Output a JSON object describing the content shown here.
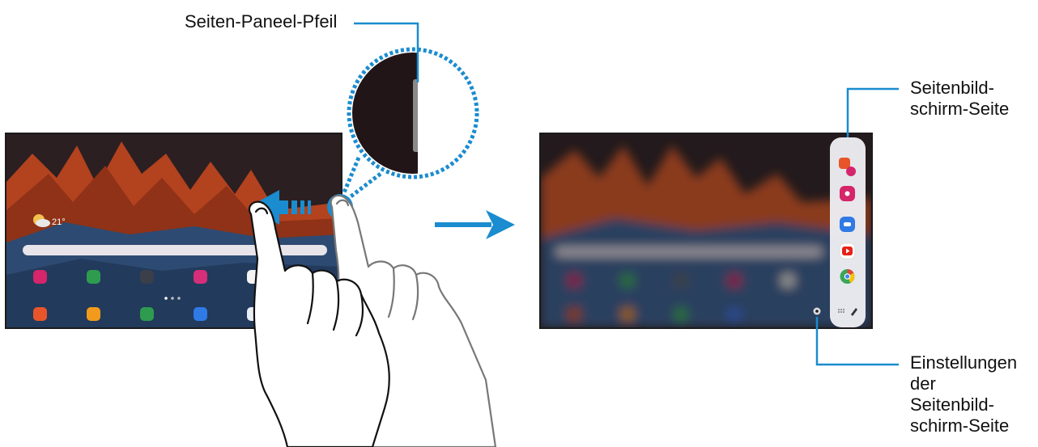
{
  "callouts": {
    "side_panel_arrow": "Seiten-Paneel-Pfeil",
    "edge_screen_page_1": "Seitenbild-",
    "edge_screen_page_2": "schirm-Seite",
    "edge_settings_1": "Einstellungen",
    "edge_settings_2": "der",
    "edge_settings_3": "Seitenbild-",
    "edge_settings_4": "schirm-Seite"
  },
  "home_screen": {
    "weather_temp": "21°"
  },
  "colors": {
    "callout_line": "#1a8ccf",
    "arrow_blue": "#1a8ccf",
    "screen_border": "#1b1b1b",
    "wallpaper_dark": "#2b1f22",
    "wallpaper_orange": "#b3421e",
    "wallpaper_blue": "#2d4a72"
  },
  "icons": {
    "left_screen_row1": [
      "gallery-icon",
      "memo-icon",
      "tools-icon",
      "store-icon",
      "play-store-icon"
    ],
    "left_screen_row2": [
      "notes-icon",
      "folder-icon",
      "phone-icon",
      "messages-icon",
      "chat-icon"
    ],
    "edge_panel": [
      "app-pair-icon",
      "gallery-icon",
      "messages-icon",
      "youtube-icon",
      "chrome-icon"
    ]
  }
}
